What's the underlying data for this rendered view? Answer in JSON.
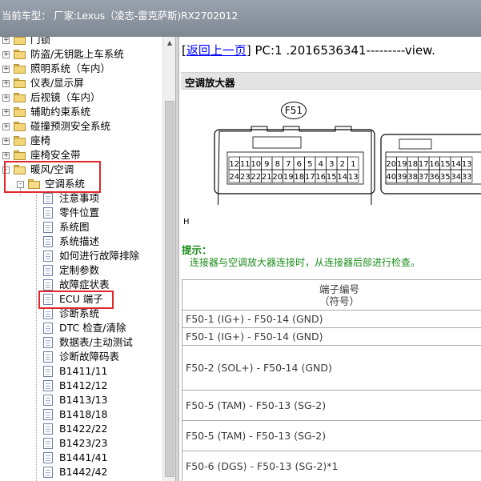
{
  "title_bar": {
    "text": "当前车型： 厂家:Lexus（凌志-雷克萨斯)RX2702012"
  },
  "tree": {
    "items": [
      {
        "label": "门锁",
        "type": "folder",
        "level": 0
      },
      {
        "label": "防盗/无钥匙上车系统",
        "type": "folder",
        "level": 0
      },
      {
        "label": "照明系统（车内）",
        "type": "folder",
        "level": 0
      },
      {
        "label": "仪表/显示屏",
        "type": "folder",
        "level": 0
      },
      {
        "label": "后视镜（车内）",
        "type": "folder",
        "level": 0
      },
      {
        "label": "辅助约束系统",
        "type": "folder",
        "level": 0
      },
      {
        "label": "碰撞预测安全系统",
        "type": "folder",
        "level": 0
      },
      {
        "label": "座椅",
        "type": "folder",
        "level": 0
      },
      {
        "label": "座椅安全带",
        "type": "folder",
        "level": 0
      },
      {
        "label": "暖风/空调",
        "type": "folder-open",
        "level": 0
      },
      {
        "label": "空调系统",
        "type": "folder-open",
        "level": 1
      },
      {
        "label": "注意事项",
        "type": "doc",
        "level": 2
      },
      {
        "label": "零件位置",
        "type": "doc",
        "level": 2
      },
      {
        "label": "系统图",
        "type": "doc",
        "level": 2
      },
      {
        "label": "系统描述",
        "type": "doc",
        "level": 2
      },
      {
        "label": "如何进行故障排除",
        "type": "doc",
        "level": 2
      },
      {
        "label": "定制参数",
        "type": "doc",
        "level": 2
      },
      {
        "label": "故障症状表",
        "type": "doc",
        "level": 2
      },
      {
        "label": "ECU 端子",
        "type": "doc",
        "level": 2
      },
      {
        "label": "诊断系统",
        "type": "doc",
        "level": 2
      },
      {
        "label": "DTC 检查/清除",
        "type": "doc",
        "level": 2
      },
      {
        "label": "数据表/主动测试",
        "type": "doc",
        "level": 2
      },
      {
        "label": "诊断故障码表",
        "type": "doc",
        "level": 2
      },
      {
        "label": "B1411/11",
        "type": "doc",
        "level": 2
      },
      {
        "label": "B1412/12",
        "type": "doc",
        "level": 2
      },
      {
        "label": "B1413/13",
        "type": "doc",
        "level": 2
      },
      {
        "label": "B1418/18",
        "type": "doc",
        "level": 2
      },
      {
        "label": "B1422/22",
        "type": "doc",
        "level": 2
      },
      {
        "label": "B1423/23",
        "type": "doc",
        "level": 2
      },
      {
        "label": "B1441/41",
        "type": "doc",
        "level": 2
      },
      {
        "label": "B1442/42",
        "type": "doc",
        "level": 2
      }
    ],
    "expand_symbol": "+",
    "collapse_symbol": "-"
  },
  "content": {
    "back_link": "返回上一页",
    "pc_text": " PC:1 .2016536341---------view.",
    "section_title": "空调放大器",
    "connector_name": "F51",
    "connector_row1": [
      "12",
      "11",
      "10",
      "9",
      "8",
      "7",
      "6",
      "5",
      "4",
      "3",
      "2",
      "1"
    ],
    "connector_row2": [
      "24",
      "23",
      "22",
      "21",
      "20",
      "19",
      "18",
      "17",
      "16",
      "15",
      "14",
      "13"
    ],
    "connector2_row1": [
      "20",
      "19",
      "18",
      "17",
      "16",
      "15",
      "14",
      "13"
    ],
    "connector2_row2": [
      "40",
      "39",
      "38",
      "37",
      "36",
      "35",
      "34",
      "33"
    ],
    "h_mark": "H",
    "hint_title": "提示：",
    "hint_text": "连接器与空调放大器连接时，从连接器后部进行检查。",
    "table_header_line1": "端子编号",
    "table_header_line2": "（符号）",
    "rows": [
      "F50-1 (IG+) - F50-14 (GND)",
      "F50-1 (IG+) - F50-14 (GND)",
      "F50-2 (SOL+) - F50-14 (GND)",
      "F50-5 (TAM) - F50-13 (SG-2)",
      "F50-5 (TAM) - F50-13 (SG-2)",
      "F50-6 (DGS) - F50-13 (SG-2)*1"
    ]
  },
  "colors": {
    "highlight": "#e0262b",
    "hint": "#1b8c1b",
    "link": "#0000ff"
  }
}
